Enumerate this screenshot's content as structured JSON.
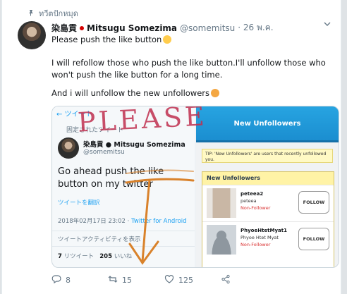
{
  "pinned_label": "ทวีตปักหมุด",
  "tweet": {
    "display_name": "染島貢",
    "display_name_en": "Mitsugu Somezima",
    "handle": "@somemitsu",
    "date": "· 26 พ.ค.",
    "line1": "Please push the like button",
    "para2": "I will refollow those who push the like button.I'll unfollow those who won't push the like button for a long time.",
    "para3": "And i will unfollow the new unfollowers"
  },
  "screenshot_left": {
    "top_bar": "← ツイート",
    "pinned": "固定されたツイート",
    "name": "染島貢 ● Mitsugu Somezima",
    "handle": "@somemitsu",
    "body": "Go ahead push the like button on my twitter",
    "translate": "ツイートを翻訳",
    "time": "2018年02月17日 23:02 · ",
    "via": "Twitter for Android",
    "activity": "ツイートアクティビティを表示",
    "retweets": "7",
    "retweets_label": "リツイート",
    "likes": "205",
    "likes_label": "いいね"
  },
  "screenshot_right": {
    "header": "New Unfollowers",
    "tip": "TIP: 'New Unfollowers' are users that recently unfollowed you.",
    "panel_title": "New Unfollowers",
    "rows": [
      {
        "username": "peteea2",
        "realname": "peteea",
        "status": "Non-Follower",
        "button": "FOLLOW"
      },
      {
        "username": "PhyoeHtetMyat1",
        "realname": "Phyoe Htet Myat",
        "status": "Non-Follower",
        "button": "FOLLOW"
      }
    ]
  },
  "overlay_text": "PLEASE",
  "actions": {
    "replies": "8",
    "retweets": "15",
    "likes": "125"
  },
  "colors": {
    "twitter_blue": "#1da1f2",
    "annotation_pink": "#c0304f",
    "annotation_orange": "#d9822b",
    "unfollow_red": "#d92e2e"
  }
}
